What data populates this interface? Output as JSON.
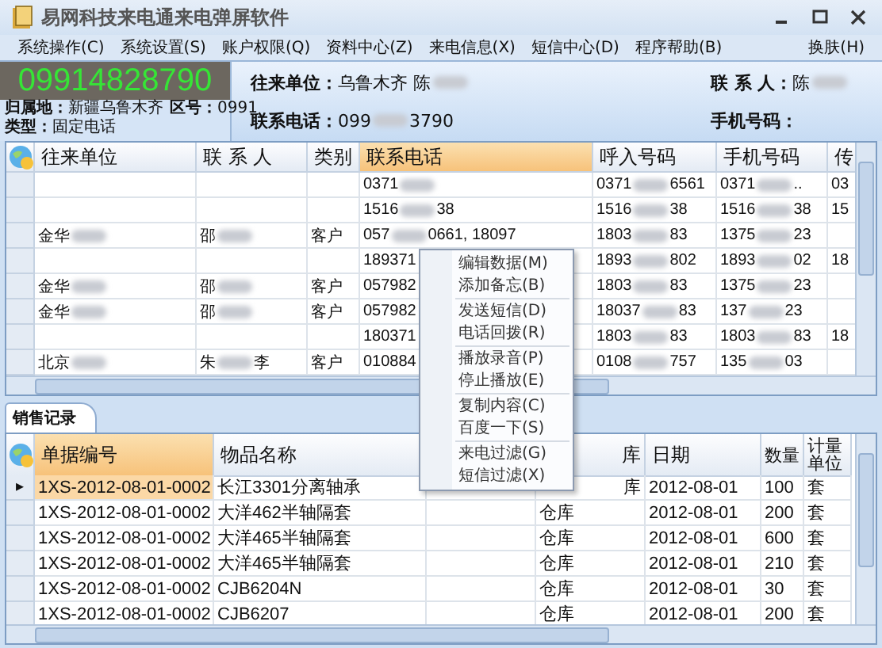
{
  "window": {
    "title": "易网科技来电通来电弹屏软件"
  },
  "menu": [
    {
      "label": "系统操作(C)"
    },
    {
      "label": "系统设置(S)"
    },
    {
      "label": "账户权限(Q)"
    },
    {
      "label": "资料中心(Z)"
    },
    {
      "label": "来电信息(X)"
    },
    {
      "label": "短信中心(D)"
    },
    {
      "label": "程序帮助(B)"
    }
  ],
  "skin_menu": "换肤(H)",
  "caller": {
    "number": "09914828790",
    "location_label": "归属地：",
    "location": "新疆乌鲁木齐",
    "area_label": "区号：",
    "area": "0991",
    "type_label": "类型：",
    "type": "固定电话"
  },
  "info": [
    {
      "label": "往来单位：",
      "value": {
        "kind": "redacted",
        "text": "乌鲁木齐 陈"
      }
    },
    {
      "label": "联 系 人：",
      "value": {
        "kind": "redacted",
        "text": "陈"
      }
    },
    {
      "label": "联系电话：",
      "value": {
        "kind": "redacted",
        "text": "099",
        "tail": "3790"
      }
    },
    {
      "label": "手机号码："
    }
  ],
  "contacts": {
    "columns": [
      {
        "label": "往来单位",
        "selected": false
      },
      {
        "label": "联 系 人",
        "selected": false
      },
      {
        "label": "类别",
        "selected": false
      },
      {
        "label": "联系电话",
        "selected": true
      },
      {
        "label": "呼入号码",
        "selected": false
      },
      {
        "label": "手机号码",
        "selected": false
      },
      {
        "label": "传",
        "selected": false
      }
    ],
    "rows": [
      [
        null,
        null,
        null,
        {
          "kind": "redacted",
          "text": "0371"
        },
        {
          "kind": "redacted",
          "text": "0371",
          "tail": "6561"
        },
        {
          "kind": "redacted",
          "text": "0371",
          "tail": ".."
        },
        "03"
      ],
      [
        null,
        null,
        null,
        {
          "kind": "redacted",
          "text": "1516",
          "tail": "38"
        },
        {
          "kind": "redacted",
          "text": "1516",
          "tail": "38"
        },
        {
          "kind": "redacted",
          "text": "1516",
          "tail": "38"
        },
        "15"
      ],
      [
        {
          "kind": "redacted",
          "text": "金华"
        },
        {
          "kind": "redacted",
          "text": "邵"
        },
        "客户",
        {
          "kind": "redacted",
          "text": "057",
          "tail": "0661, 18097"
        },
        {
          "kind": "redacted",
          "text": "1803",
          "tail": "83"
        },
        {
          "kind": "redacted",
          "text": "1375",
          "tail": "23"
        },
        null
      ],
      [
        null,
        null,
        null,
        "189371",
        {
          "kind": "redacted",
          "text": "1893",
          "tail": "802"
        },
        {
          "kind": "redacted",
          "text": "1893",
          "tail": "02"
        },
        "18"
      ],
      [
        {
          "kind": "redacted",
          "text": "金华"
        },
        {
          "kind": "redacted",
          "text": "邵"
        },
        "客户",
        "057982",
        {
          "kind": "redacted",
          "text": "1803",
          "tail": "83"
        },
        {
          "kind": "redacted",
          "text": "1375",
          "tail": "23"
        },
        null
      ],
      [
        {
          "kind": "redacted",
          "text": "金华"
        },
        {
          "kind": "redacted",
          "text": "邵"
        },
        "客户",
        "057982",
        {
          "kind": "redacted",
          "text": "18037",
          "tail": "83"
        },
        {
          "kind": "redacted",
          "text": "137",
          "tail": "23"
        },
        null
      ],
      [
        null,
        null,
        null,
        "180371",
        {
          "kind": "redacted",
          "text": "1803",
          "tail": "83"
        },
        {
          "kind": "redacted",
          "text": "1803",
          "tail": "83"
        },
        "18"
      ],
      [
        {
          "kind": "redacted",
          "text": "北京"
        },
        {
          "kind": "redacted",
          "text": "朱",
          "tail": "李"
        },
        "客户",
        "010884",
        {
          "kind": "redacted",
          "text": "0108",
          "tail": "757"
        },
        {
          "kind": "redacted",
          "text": "135",
          "tail": "03"
        },
        null
      ]
    ]
  },
  "tab": {
    "label": "销售记录",
    "selected": true
  },
  "sales": {
    "columns": [
      {
        "label": "单据编号",
        "selected": true
      },
      {
        "label": "物品名称",
        "selected": false
      },
      {
        "label": "库",
        "selected": false,
        "partial": true
      },
      {
        "label": "日期",
        "selected": false
      },
      {
        "label": "数量",
        "selected": false
      },
      {
        "label": "计量单位",
        "selected": false
      }
    ],
    "rows": [
      {
        "selected": true,
        "marker": "▸",
        "cells": [
          "1XS-2012-08-01-0002",
          "长江3301分离轴承",
          "库",
          "2012-08-01",
          "100",
          "套"
        ]
      },
      {
        "selected": false,
        "cells": [
          "1XS-2012-08-01-0002",
          "大洋462半轴隔套",
          "仓库",
          "2012-08-01",
          "200",
          "套"
        ]
      },
      {
        "selected": false,
        "cells": [
          "1XS-2012-08-01-0002",
          "大洋465半轴隔套",
          "仓库",
          "2012-08-01",
          "600",
          "套"
        ]
      },
      {
        "selected": false,
        "cells": [
          "1XS-2012-08-01-0002",
          "大洋465半轴隔套",
          "仓库",
          "2012-08-01",
          "210",
          "套"
        ]
      },
      {
        "selected": false,
        "cells": [
          "1XS-2012-08-01-0002",
          "CJB6204N",
          "仓库",
          "2012-08-01",
          "30",
          "套"
        ]
      },
      {
        "selected": false,
        "cells": [
          "1XS-2012-08-01-0002",
          "CJB6207",
          "仓库",
          "2012-08-01",
          "200",
          "套"
        ]
      }
    ]
  },
  "context_menu": [
    [
      "编辑数据(M)",
      "添加备忘(B)"
    ],
    [
      "发送短信(D)",
      "电话回拨(R)"
    ],
    [
      "播放录音(P)",
      "停止播放(E)"
    ],
    [
      "复制内容(C)",
      "百度一下(S)"
    ],
    [
      "来电过滤(G)",
      "短信过滤(X)"
    ]
  ]
}
